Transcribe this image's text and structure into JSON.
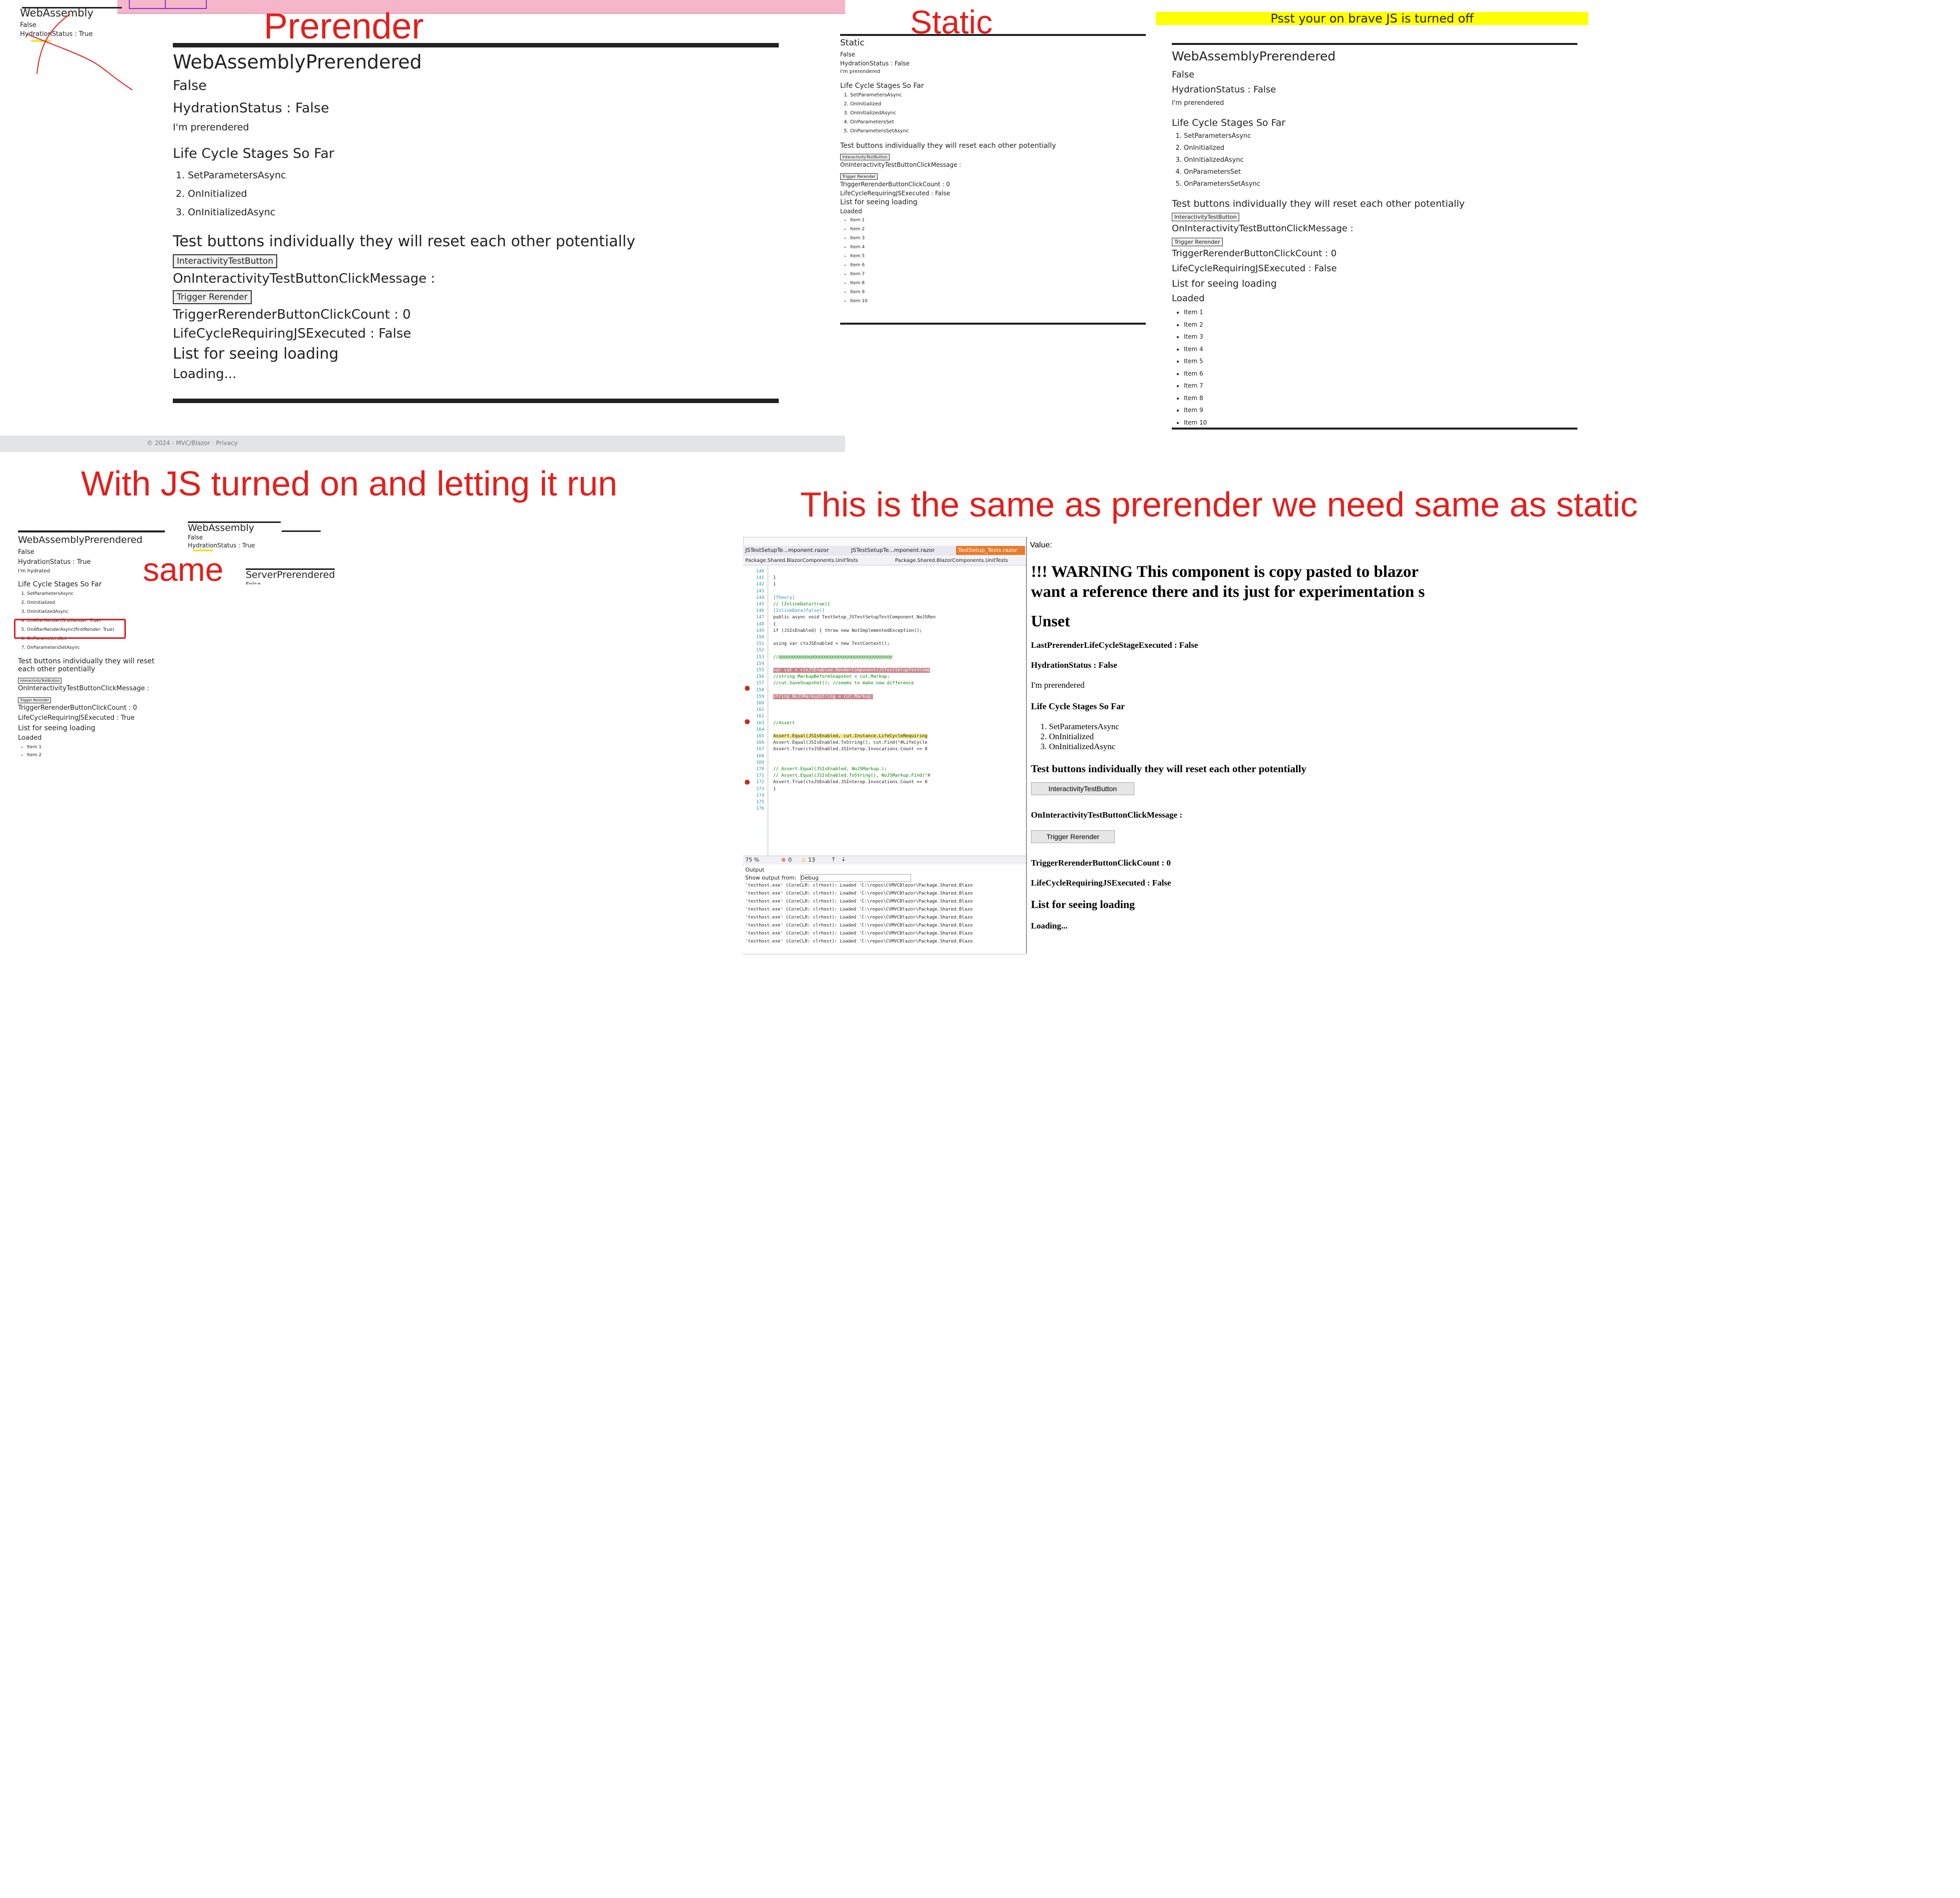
{
  "annotations": {
    "prerender": "Prerender",
    "static": "Static",
    "js_on": "With JS turned on and letting it run",
    "same": "same",
    "bottom_right": "This is the same as prerender we need same as static"
  },
  "prerender_panel": {
    "mini": {
      "title": "WebAssembly",
      "line1": "False",
      "line2": "HydrationStatus : True"
    },
    "footer_text": "© 2024 - MVC/Blazor · Privacy",
    "card": {
      "title": "WebAssemblyPrerendered",
      "value": "False",
      "hydration": "HydrationStatus : False",
      "note": "I'm prerendered",
      "lifecycle_heading": "Life Cycle Stages So Far",
      "stages": [
        "SetParametersAsync",
        "OnInitialized",
        "OnInitializedAsync"
      ],
      "test_heading": "Test buttons individually they will reset each other potentially",
      "interactivity_button": "InteractivityTestButton",
      "onint_message": "OnInteractivityTestButtonClickMessage :",
      "rerender_button": "Trigger Rerender",
      "rerender_count": "TriggerRerenderButtonClickCount : 0",
      "js_executed": "LifeCycleRequiringJSExecuted : False",
      "list_heading": "List for seeing loading",
      "loading": "Loading..."
    }
  },
  "static_panel": {
    "title": "Static",
    "value": "False",
    "hydration": "HydrationStatus : False",
    "note": "I'm prerendered",
    "lifecycle_heading": "Life Cycle Stages So Far",
    "stages": [
      "SetParametersAsync",
      "OnInitialized",
      "OnInitializedAsync",
      "OnParametersSet",
      "OnParametersSetAsync"
    ],
    "test_heading": "Test buttons individually they will reset each other potentially",
    "interactivity_button": "InteractivityTestButton",
    "onint_message": "OnInteractivityTestButtonClickMessage :",
    "rerender_button": "Trigger Rerender",
    "rerender_count": "TriggerRerenderButtonClickCount : 0",
    "js_executed": "LifeCycleRequiringJSExecuted : False",
    "list_heading": "List for seeing loading",
    "loaded": "Loaded",
    "items": [
      "Item 1",
      "Item 2",
      "Item 3",
      "Item 4",
      "Item 5",
      "Item 6",
      "Item 7",
      "Item 8",
      "Item 9",
      "Item 10"
    ]
  },
  "brave_panel": {
    "banner": "Psst your on brave JS is turned off",
    "title": "WebAssemblyPrerendered",
    "value": "False",
    "hydration": "HydrationStatus : False",
    "note": "I'm prerendered",
    "lifecycle_heading": "Life Cycle Stages So Far",
    "stages": [
      "SetParametersAsync",
      "OnInitialized",
      "OnInitializedAsync",
      "OnParametersSet",
      "OnParametersSetAsync"
    ],
    "test_heading": "Test buttons individually they will reset each other potentially",
    "interactivity_button": "InteractivityTestButton",
    "onint_message": "OnInteractivityTestButtonClickMessage :",
    "rerender_button": "Trigger Rerender",
    "rerender_count": "TriggerRerenderButtonClickCount : 0",
    "js_executed": "LifeCycleRequiringJSExecuted : False",
    "list_heading": "List for seeing loading",
    "loaded": "Loaded",
    "items": [
      "Item 1",
      "Item 2",
      "Item 3",
      "Item 4",
      "Item 5",
      "Item 6",
      "Item 7",
      "Item 8",
      "Item 9",
      "Item 10"
    ]
  },
  "js_panel": {
    "title": "WebAssemblyPrerendered",
    "value": "False",
    "hydration": "HydrationStatus : True",
    "note": "I'm hydrated",
    "lifecycle_heading": "Life Cycle Stages So Far",
    "stages": [
      "SetParametersAsync",
      "OnInitialized",
      "OnInitializedAsync",
      "OnAfterRender(firstRender: True)",
      "OnAfterRenderAsync(firstRender: True)",
      "OnParametersSet",
      "OnParametersSetAsync"
    ],
    "test_heading": "Test buttons individually they will reset each other potentially",
    "interactivity_button": "InteractivityTestButton",
    "onint_message": "OnInteractivityTestButtonClickMessage :",
    "rerender_button": "Trigger Rerender",
    "rerender_count": "TriggerRerenderButtonClickCount : 0",
    "js_executed": "LifeCycleRequiringJSExecuted : True",
    "list_heading": "List for seeing loading",
    "loaded": "Loaded",
    "items": [
      "Item 1",
      "Item 2"
    ],
    "mini1": {
      "title": "WebAssembly",
      "line1": "False",
      "line2": "HydrationStatus : True"
    },
    "mini2": {
      "title": "ServerPrerendered",
      "line1": "False"
    }
  },
  "vs_panel": {
    "tabs": [
      "JSTestSetupTe...mponent.razor",
      "JSTestSetupTe...mponent.razor",
      "TestSetup_Tests.razor"
    ],
    "subtabs": [
      "Package.Shared.BlazorComponents.UnitTests",
      "Package.Shared.BlazorComponents.UnitTests"
    ],
    "lines": [
      {
        "n": "140",
        "t": ""
      },
      {
        "n": "141",
        "t": "        }"
      },
      {
        "n": "142",
        "t": "        }"
      },
      {
        "n": "143",
        "t": ""
      },
      {
        "n": "144",
        "t": "        [Theory]"
      },
      {
        "n": "145",
        "t": "        // [InlineData(true)]"
      },
      {
        "n": "146",
        "t": "        [InlineData(false)]"
      },
      {
        "n": "147",
        "t": "        public async void TestSetup_JSTestSetupTestComponent_NoJSRen"
      },
      {
        "n": "148",
        "t": "        {"
      },
      {
        "n": "149",
        "t": "            if (JSIsEnabled) { throw new NotImplementedException();"
      },
      {
        "n": "150",
        "t": ""
      },
      {
        "n": "151",
        "t": "            using var ctxJSEnabled = new TestContext();"
      },
      {
        "n": "152",
        "t": ""
      },
      {
        "n": "153",
        "t": "            //@@@@@@@@@@@@@@@@@@@@@@@@@@@@@@@@@@@@@@@@@@"
      },
      {
        "n": "154",
        "t": ""
      },
      {
        "n": "155",
        "t": "            var cut = ctxJSEnabled.RenderComponent<JSTestSetupTestComp"
      },
      {
        "n": "156",
        "t": "            //string MarkupBeforeSnapshot = cut.Markup;"
      },
      {
        "n": "157",
        "t": "            //cut.SaveSnapshot(); //seems to make now difference"
      },
      {
        "n": "158",
        "t": ""
      },
      {
        "n": "159",
        "t": "            string NoJSMarkupString = cut.Markup;"
      },
      {
        "n": "160",
        "t": ""
      },
      {
        "n": "161",
        "t": ""
      },
      {
        "n": "162",
        "t": ""
      },
      {
        "n": "163",
        "t": "            //Assert"
      },
      {
        "n": "164",
        "t": ""
      },
      {
        "n": "165",
        "t": "            Assert.Equal(JSIsEnabled, cut.Instance.LifeCycleRequiring"
      },
      {
        "n": "166",
        "t": "            Assert.Equal(JSIsEnabled.ToString(), cut.Find(\"#LifeCycle"
      },
      {
        "n": "167",
        "t": "            Assert.True(ctxJSEnabled.JSInterop.Invocations.Count == 0"
      },
      {
        "n": "168",
        "t": ""
      },
      {
        "n": "169",
        "t": ""
      },
      {
        "n": "170",
        "t": "            // Assert.Equal(JSIsEnabled, NoJSMarkup.);"
      },
      {
        "n": "171",
        "t": "            // Assert.Equal(JSIsEnabled.ToString(), NoJSMarkup.Find(\"#"
      },
      {
        "n": "172",
        "t": "            Assert.True(ctxJSEnabled.JSInterop.Invocations.Count == 0"
      },
      {
        "n": "173",
        "t": "        }"
      },
      {
        "n": "174",
        "t": ""
      },
      {
        "n": "175",
        "t": ""
      },
      {
        "n": "176",
        "t": ""
      }
    ],
    "zoom": "75 %",
    "errors": "0",
    "warnings": "13",
    "output_title": "Output",
    "show_output_label": "Show output from:",
    "output_source": "Debug",
    "log_lines": [
      "'testhost.exe' (CoreCLR: clrhost): Loaded 'C:\\repos\\CVMVCBlazor\\Package.Shared.Blazo",
      "'testhost.exe' (CoreCLR: clrhost): Loaded 'C:\\repos\\CVMVCBlazor\\Package.Shared.Blazo",
      "'testhost.exe' (CoreCLR: clrhost): Loaded 'C:\\repos\\CVMVCBlazor\\Package.Shared.Blazo",
      "'testhost.exe' (CoreCLR: clrhost): Loaded 'C:\\repos\\CVMVCBlazor\\Package.Shared.Blazo",
      "'testhost.exe' (CoreCLR: clrhost): Loaded 'C:\\repos\\CVMVCBlazor\\Package.Shared.Blazo",
      "'testhost.exe' (CoreCLR: clrhost): Loaded 'C:\\repos\\CVMVCBlazor\\Package.Shared.Blazo",
      "'testhost.exe' (CoreCLR: clrhost): Loaded 'C:\\repos\\CVMVCBlazor\\Package.Shared.Blazo",
      "'testhost.exe' (CoreCLR: clrhost): Loaded 'C:\\repos\\CVMVCBlazor\\Package.Shared.Blazo"
    ]
  },
  "value_panel": {
    "label": "Value:",
    "warning_line1": "!!! WARNING This component is copy pasted to blazor",
    "warning_line2": "want a reference there and its just for experimentation s",
    "unset": "Unset",
    "last_prerender": "LastPrerenderLifeCycleStageExecuted : False",
    "hydration": "HydrationStatus : False",
    "note": "I'm prerendered",
    "lifecycle_heading": "Life Cycle Stages So Far",
    "stages": [
      "SetParametersAsync",
      "OnInitialized",
      "OnInitializedAsync"
    ],
    "test_heading": "Test buttons individually they will reset each other potentially",
    "interactivity_button": "InteractivityTestButton",
    "onint_message": "OnInteractivityTestButtonClickMessage :",
    "rerender_button": "Trigger Rerender",
    "rerender_count": "TriggerRerenderButtonClickCount : 0",
    "js_executed": "LifeCycleRequiringJSExecuted : False",
    "list_heading": "List for seeing loading",
    "loading": "Loading..."
  }
}
